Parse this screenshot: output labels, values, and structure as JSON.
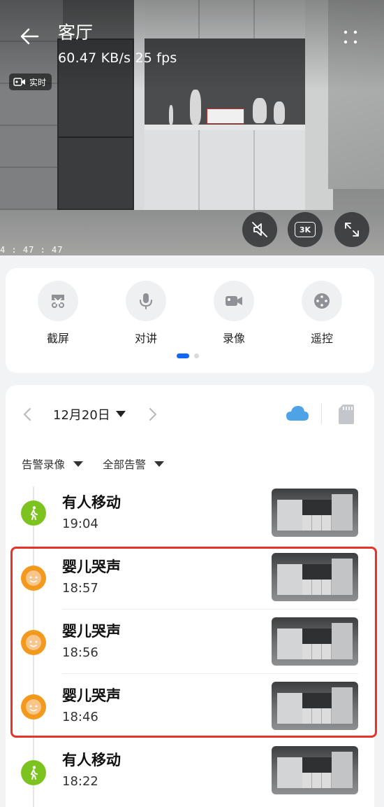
{
  "header": {
    "title": "客厅",
    "stats": "60.47 KB/s  25 fps",
    "live_label": "实时",
    "timestamp": "4 : 47 : 47",
    "quality_label": "3K"
  },
  "tools": [
    {
      "label": "截屏",
      "icon": "screenshot-icon"
    },
    {
      "label": "对讲",
      "icon": "microphone-icon"
    },
    {
      "label": "录像",
      "icon": "video-camera-icon"
    },
    {
      "label": "遥控",
      "icon": "gamepad-icon"
    }
  ],
  "pager": {
    "pages": 2,
    "active": 0
  },
  "events_panel": {
    "date": "12月20日",
    "filters": [
      "告警录像",
      "全部告警"
    ],
    "events": [
      {
        "title": "有人移动",
        "time": "19:04",
        "type": "motion",
        "icon": "walking-person-icon",
        "color": "#7cc320"
      },
      {
        "title": "婴儿哭声",
        "time": "18:57",
        "type": "baby-cry",
        "icon": "baby-face-icon",
        "color": "#f39a1e"
      },
      {
        "title": "婴儿哭声",
        "time": "18:56",
        "type": "baby-cry",
        "icon": "baby-face-icon",
        "color": "#f39a1e"
      },
      {
        "title": "婴儿哭声",
        "time": "18:46",
        "type": "baby-cry",
        "icon": "baby-face-icon",
        "color": "#f39a1e"
      },
      {
        "title": "有人移动",
        "time": "18:22",
        "type": "motion",
        "icon": "walking-person-icon",
        "color": "#7cc320"
      }
    ]
  },
  "colors": {
    "accent": "#1467f5",
    "highlight_border": "#e8332b",
    "cloud": "#4ea3e6"
  }
}
